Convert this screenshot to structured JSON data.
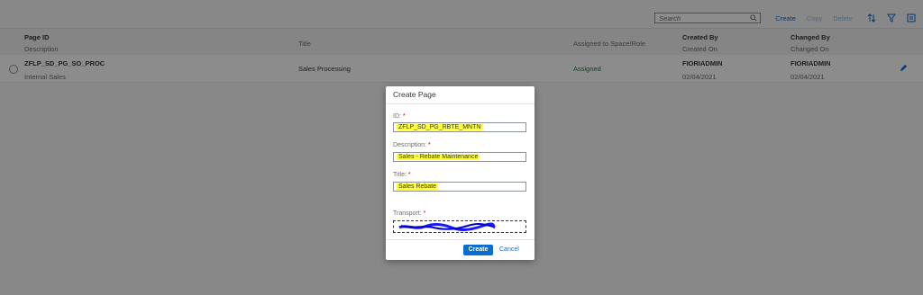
{
  "toolbar": {
    "search_placeholder": "Search",
    "create": "Create",
    "copy": "Copy",
    "delete": "Delete",
    "sort_icon": "sort-icon",
    "filter_icon": "filter-icon",
    "settings_icon": "column-settings-icon"
  },
  "table": {
    "headers": {
      "page_id": "Page ID",
      "description": "Description",
      "title": "Title",
      "assigned": "Assigned to Space/Role",
      "created_by": "Created By",
      "created_on": "Created On",
      "changed_by": "Changed By",
      "changed_on": "Changed On"
    },
    "rows": [
      {
        "page_id": "ZFLP_SD_PG_SO_PROC",
        "description": "Internal Sales",
        "title": "Sales Processing",
        "assigned": "Assigned",
        "created_by": "FIORIADMIN",
        "created_on": "02/04/2021",
        "changed_by": "FIORIADMIN",
        "changed_on": "02/04/2021"
      }
    ]
  },
  "dialog": {
    "title": "Create Page",
    "id_label": "ID:",
    "id_value": "ZFLP_SD_PG_RBTE_MNTN",
    "description_label": "Description:",
    "description_value": "Sales - Rebate Maintenance",
    "title_label": "Title:",
    "title_value": "Sales Rebate",
    "transport_label": "Transport:",
    "required_mark": "*",
    "create_button": "Create",
    "cancel_button": "Cancel"
  },
  "colors": {
    "accent": "#0a6ed1",
    "highlight": "#ffff33",
    "assigned": "#107e3e",
    "required": "#bb0000"
  }
}
